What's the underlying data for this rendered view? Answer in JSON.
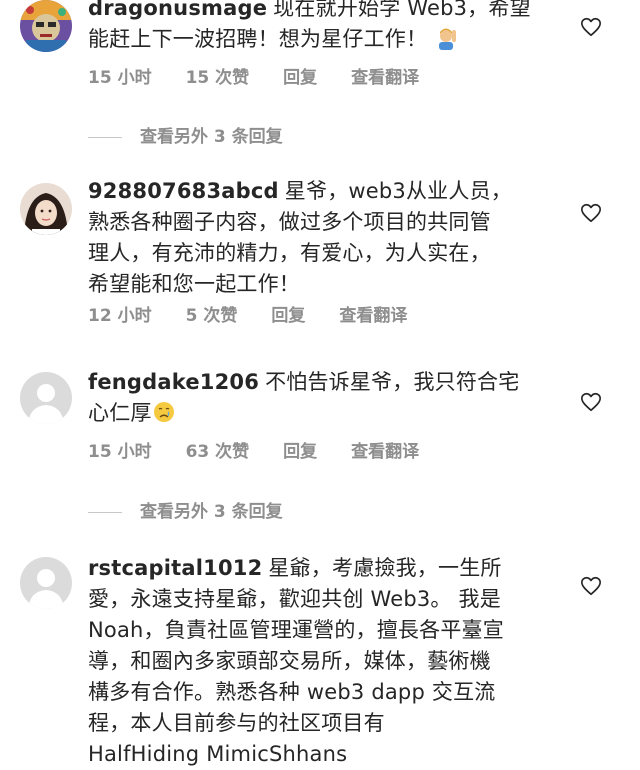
{
  "comments": [
    {
      "username": "dragonusmage",
      "lines": [
        "现在就开始学 Web3，希望",
        "能赶上下一波招聘！想为星仔工作！"
      ],
      "time": "15 小时",
      "likes": "15 次赞",
      "reply": "回复",
      "translate": "查看翻译",
      "avatar_icon": "colorful-artwork-avatar",
      "trailing_emoji": "person-raising-hand-emoji"
    },
    {
      "username": "928807683abcd",
      "lines": [
        "星爷，web3从业人员，",
        "熟悉各种圈子内容，做过多个项目的共同管",
        "理人，有充沛的精力，有爱心，为人实在，",
        "希望能和您一起工作！"
      ],
      "time": "12 小时",
      "likes": "5 次赞",
      "reply": "回复",
      "translate": "查看翻译",
      "avatar_icon": "girl-photo-avatar"
    },
    {
      "username": "fengdake1206",
      "lines": [
        "不怕告诉星爷，我只符合宅",
        "心仁厚"
      ],
      "time": "15 小时",
      "likes": "63 次赞",
      "reply": "回复",
      "translate": "查看翻译",
      "avatar_icon": "default-avatar",
      "trailing_emoji": "crying-face-emoji"
    },
    {
      "username": "rstcapital1012",
      "lines": [
        "星爺，考慮撿我，一生所",
        "愛，永遠支持星爺，歡迎共创 Web3。 我是",
        "Noah，負責社區管理運營的，擅長各平臺宣",
        "導，和圈內多家頭部交易所，媒体，藝術機",
        "構多有合作。熟悉各种 web3 dapp 交互流",
        "程，本人目前参与的社区项目有",
        "HalfHiding MimicShhans"
      ],
      "avatar_icon": "default-avatar"
    }
  ],
  "more_replies": [
    {
      "label": "查看另外 3 条回复"
    },
    {
      "label": "查看另外 3 条回复"
    }
  ],
  "icons": {
    "like": "heart-outline-icon"
  },
  "colors": {
    "text": "#262626",
    "secondary": "#8e8e8e",
    "divider": "#c7c7c7"
  }
}
